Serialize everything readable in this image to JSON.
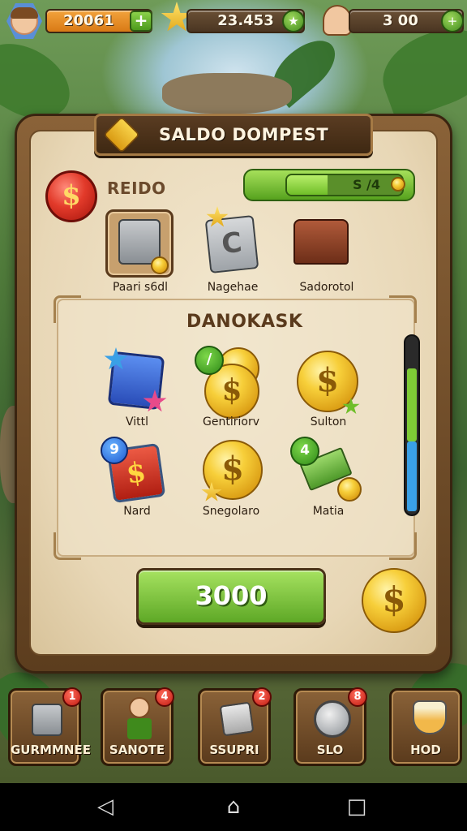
{
  "top_bar": {
    "player_currency": "20061",
    "star_currency": "23.453",
    "friends_currency": "3 00",
    "plus_symbol": "+",
    "star_symbol": "★"
  },
  "shop": {
    "title": "SALDO DOMPEST",
    "section_label": "REIDO",
    "currency_symbol": "$",
    "progress_text": "S /4",
    "progress_fraction": 0.35,
    "featured_items": [
      {
        "caption": "Paari s6dl",
        "icon": "safe-icon"
      },
      {
        "caption": "Nagehae",
        "icon": "silver-card-icon"
      },
      {
        "caption": "Sadorotol",
        "icon": "treasure-chest-icon"
      }
    ],
    "grid_title": "DANOKASK",
    "grid_items": [
      {
        "caption": "Vittl",
        "icon": "blue-card-icon"
      },
      {
        "caption": "Gentiriorv",
        "icon": "coin-stack-icon"
      },
      {
        "caption": "Sulton",
        "icon": "gold-coin-icon"
      },
      {
        "caption": "Nard",
        "icon": "red-card-icon"
      },
      {
        "caption": "Snegolaro",
        "icon": "gold-coin-icon"
      },
      {
        "caption": "Matia",
        "icon": "money-bill-icon"
      }
    ],
    "grid_badges": {
      "star": "★",
      "check": "/",
      "nine": "9",
      "four": "4"
    },
    "buy_price": "3000"
  },
  "bottom_dock": [
    {
      "label": "GURMMNEE",
      "badge": "1",
      "icon": "safe-icon"
    },
    {
      "label": "SANOTE",
      "badge": "4",
      "icon": "explorer-icon"
    },
    {
      "label": "SSUPRI",
      "badge": "2",
      "icon": "box-icon"
    },
    {
      "label": "SLO",
      "badge": "8",
      "icon": "medal-icon"
    },
    {
      "label": "HOD",
      "badge": "",
      "icon": "potion-icon"
    }
  ],
  "system_nav": {
    "back_glyph": "◁",
    "home_glyph": "⌂",
    "recent_glyph": "□"
  },
  "colors": {
    "accent_green": "#6fbe28",
    "coin_gold": "#f7cf3a",
    "frame_brown": "#5c3d1e",
    "parchment": "#e8d7b6",
    "badge_red": "#c01a10"
  }
}
